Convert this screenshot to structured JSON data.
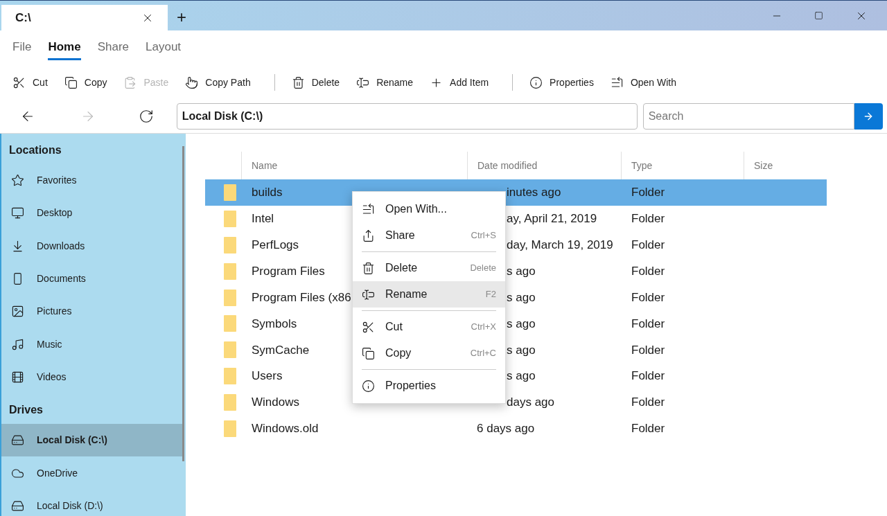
{
  "window": {
    "tab_title": "C:\\",
    "new_tab": "+"
  },
  "ribbon_tabs": [
    {
      "label": "File",
      "selected": false
    },
    {
      "label": "Home",
      "selected": true
    },
    {
      "label": "Share",
      "selected": false
    },
    {
      "label": "Layout",
      "selected": false
    }
  ],
  "toolbar": [
    {
      "kind": "button",
      "label": "Cut",
      "disabled": false
    },
    {
      "kind": "button",
      "label": "Copy",
      "disabled": false
    },
    {
      "kind": "button",
      "label": "Paste",
      "disabled": true
    },
    {
      "kind": "button",
      "label": "Copy Path",
      "disabled": false
    },
    {
      "kind": "separator"
    },
    {
      "kind": "button",
      "label": "Delete",
      "disabled": false
    },
    {
      "kind": "button",
      "label": "Rename",
      "disabled": false
    },
    {
      "kind": "button",
      "label": "Add Item",
      "disabled": false
    },
    {
      "kind": "separator"
    },
    {
      "kind": "button",
      "label": "Properties",
      "disabled": false
    },
    {
      "kind": "button",
      "label": "Open With",
      "disabled": false
    }
  ],
  "navigation": {
    "back_disabled": false,
    "forward_disabled": true,
    "address": "Local Disk (C:\\)",
    "search_placeholder": "Search"
  },
  "sidebar": {
    "sections": [
      {
        "title": "Locations",
        "items": [
          {
            "label": "Favorites",
            "selected": false
          },
          {
            "label": "Desktop",
            "selected": false
          },
          {
            "label": "Downloads",
            "selected": false
          },
          {
            "label": "Documents",
            "selected": false
          },
          {
            "label": "Pictures",
            "selected": false
          },
          {
            "label": "Music",
            "selected": false
          },
          {
            "label": "Videos",
            "selected": false
          }
        ]
      },
      {
        "title": "Drives",
        "items": [
          {
            "label": "Local Disk (C:\\)",
            "selected": true
          },
          {
            "label": "OneDrive",
            "selected": false
          },
          {
            "label": "Local Disk (D:\\)",
            "selected": false
          }
        ]
      }
    ]
  },
  "table": {
    "columns": [
      "Name",
      "Date modified",
      "Type",
      "Size"
    ],
    "rows": [
      {
        "name": "builds",
        "date": "inutes ago",
        "type": "Folder",
        "selected": true
      },
      {
        "name": "Intel",
        "date": "ay, April 21, 2019",
        "type": "Folder",
        "selected": false
      },
      {
        "name": "PerfLogs",
        "date": "day, March 19, 2019",
        "type": "Folder",
        "selected": false
      },
      {
        "name": "Program Files",
        "date": "s ago",
        "type": "Folder",
        "selected": false
      },
      {
        "name": "Program Files (x86",
        "date": "s ago",
        "type": "Folder",
        "selected": false
      },
      {
        "name": "Symbols",
        "date": "s ago",
        "type": "Folder",
        "selected": false
      },
      {
        "name": "SymCache",
        "date": "s ago",
        "type": "Folder",
        "selected": false
      },
      {
        "name": "Users",
        "date": "s ago",
        "type": "Folder",
        "selected": false
      },
      {
        "name": "Windows",
        "date": "days ago",
        "type": "Folder",
        "selected": false
      },
      {
        "name": "Windows.old",
        "date": "6 days ago",
        "type": "Folder",
        "selected": false
      }
    ]
  },
  "context_menu": [
    {
      "kind": "item",
      "label": "Open With...",
      "selected": false
    },
    {
      "kind": "item",
      "label": "Share",
      "shortcut": "Ctrl+S",
      "selected": false
    },
    {
      "kind": "separator"
    },
    {
      "kind": "item",
      "label": "Delete",
      "shortcut": "Delete",
      "selected": false
    },
    {
      "kind": "item",
      "label": "Rename",
      "shortcut": "F2",
      "selected": true
    },
    {
      "kind": "separator"
    },
    {
      "kind": "item",
      "label": "Cut",
      "shortcut": "Ctrl+X",
      "selected": false
    },
    {
      "kind": "item",
      "label": "Copy",
      "shortcut": "Ctrl+C",
      "selected": false
    },
    {
      "kind": "separator"
    },
    {
      "kind": "item",
      "label": "Properties",
      "selected": false
    }
  ]
}
